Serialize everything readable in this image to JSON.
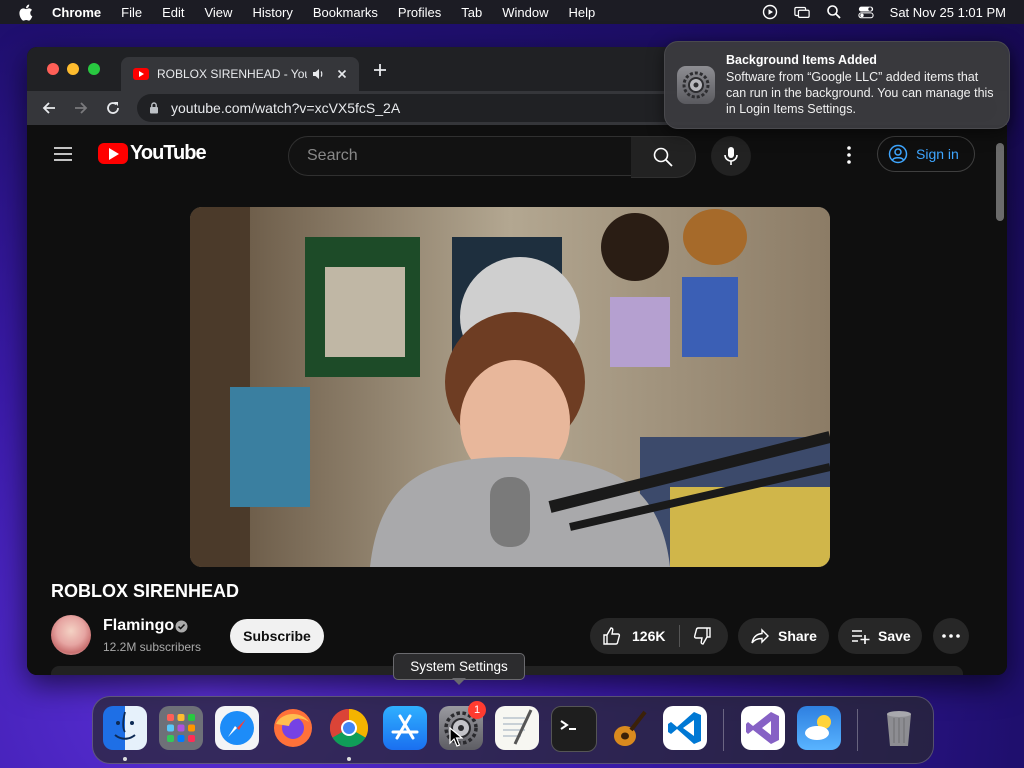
{
  "menubar": {
    "app_name": "Chrome",
    "items": [
      "File",
      "Edit",
      "View",
      "History",
      "Bookmarks",
      "Profiles",
      "Tab",
      "Window",
      "Help"
    ],
    "clock": "Sat Nov 25  1:01 PM",
    "status_icons": [
      "play-circle-icon",
      "screen-mirroring-icon",
      "search-icon",
      "control-center-icon"
    ]
  },
  "browser": {
    "tab_title": "ROBLOX SIRENHEAD - You",
    "url": "youtube.com/watch?v=xcVX5fcS_2A"
  },
  "youtube": {
    "logo_text": "YouTube",
    "search_placeholder": "Search",
    "sign_in_label": "Sign in",
    "video_title": "ROBLOX SIRENHEAD",
    "channel_name": "Flamingo",
    "subscribers": "12.2M subscribers",
    "subscribe_label": "Subscribe",
    "like_count": "126K",
    "share_label": "Share",
    "save_label": "Save",
    "accent_color": "#ff0000",
    "link_color": "#3ea6ff"
  },
  "notification": {
    "title": "Background Items Added",
    "body": "Software from “Google LLC” added items that can run in the background. You can manage this in Login Items Settings."
  },
  "tooltip": {
    "text": "System Settings"
  },
  "dock": {
    "apps": [
      "Finder",
      "Launchpad",
      "Safari",
      "Firefox",
      "Chrome",
      "App Store",
      "System Settings",
      "TextEdit",
      "Terminal",
      "GarageBand",
      "Visual Studio Code",
      "Visual Studio",
      "Weather",
      "Trash"
    ],
    "system_settings_badge": "1"
  }
}
